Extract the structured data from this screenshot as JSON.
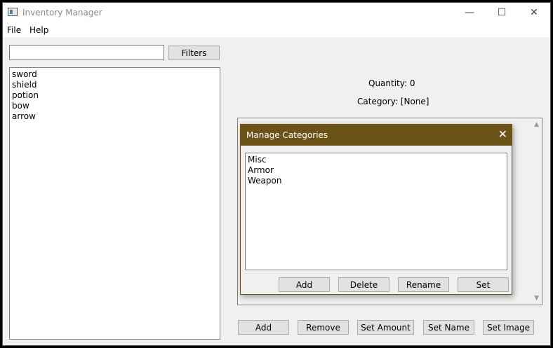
{
  "window": {
    "title": "Inventory Manager",
    "minimize_glyph": "—",
    "maximize_glyph": "☐",
    "close_glyph": "✕"
  },
  "menu": {
    "items": [
      "File",
      "Help"
    ]
  },
  "search": {
    "value": "",
    "placeholder": ""
  },
  "filters_label": "Filters",
  "items": [
    "sword",
    "shield",
    "potion",
    "bow",
    "arrow"
  ],
  "details": {
    "quantity": "Quantity: 0",
    "category": "Category: [None]"
  },
  "bottom_buttons": {
    "add": "Add",
    "remove": "Remove",
    "set_amount": "Set Amount",
    "set_name": "Set Name",
    "set_image": "Set Image"
  },
  "dialog": {
    "title": "Manage Categories",
    "close_glyph": "✕",
    "categories": [
      "Misc",
      "Armor",
      "Weapon"
    ],
    "buttons": {
      "add": "Add",
      "delete": "Delete",
      "rename": "Rename",
      "set": "Set"
    }
  },
  "colors": {
    "dialog_accent": "#6b5318"
  }
}
